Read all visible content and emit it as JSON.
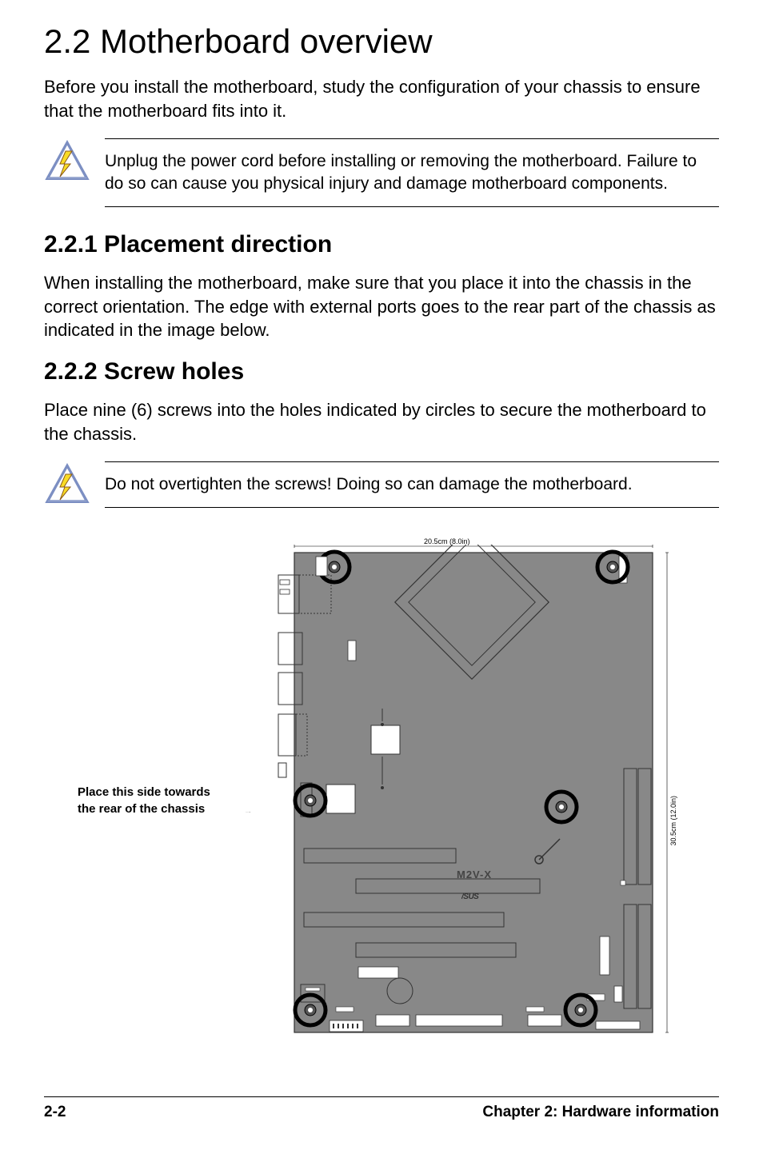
{
  "heading": {
    "main": "2.2  Motherboard overview"
  },
  "paragraphs": {
    "intro": "Before you install the motherboard, study the configuration of your chassis to ensure that the motherboard fits into it.",
    "placement_body": "When installing the motherboard, make sure that you place it into the chassis in the correct orientation. The edge with external ports goes to the rear part of the chassis as indicated in the image below.",
    "screw_body": "Place nine (6) screws into the holes indicated by circles to secure the motherboard to the chassis."
  },
  "warnings": {
    "warning1": "Unplug the power cord before installing or removing the motherboard. Failure to do so can cause you physical injury and damage motherboard components.",
    "warning2": "Do not overtighten the screws! Doing so can damage the motherboard."
  },
  "subheadings": {
    "placement": "2.2.1  Placement direction",
    "screw": "2.2.2  Screw holes"
  },
  "diagram": {
    "side_label": "Place this side towards the rear of the chassis",
    "dimension_top": "20.5cm (8.0in)",
    "dimension_side": "30.5cm (12.0in)",
    "board_model": "M2V-X"
  },
  "footer": {
    "page": "2-2",
    "chapter": "Chapter 2: Hardware information"
  },
  "colors": {
    "board_fill": "#888888",
    "board_stroke": "#333333",
    "warning_triangle_stroke": "#7b8ec2",
    "warning_bolt_fill": "#f9dc26",
    "warning_bolt_stroke": "#8a5a1a"
  }
}
